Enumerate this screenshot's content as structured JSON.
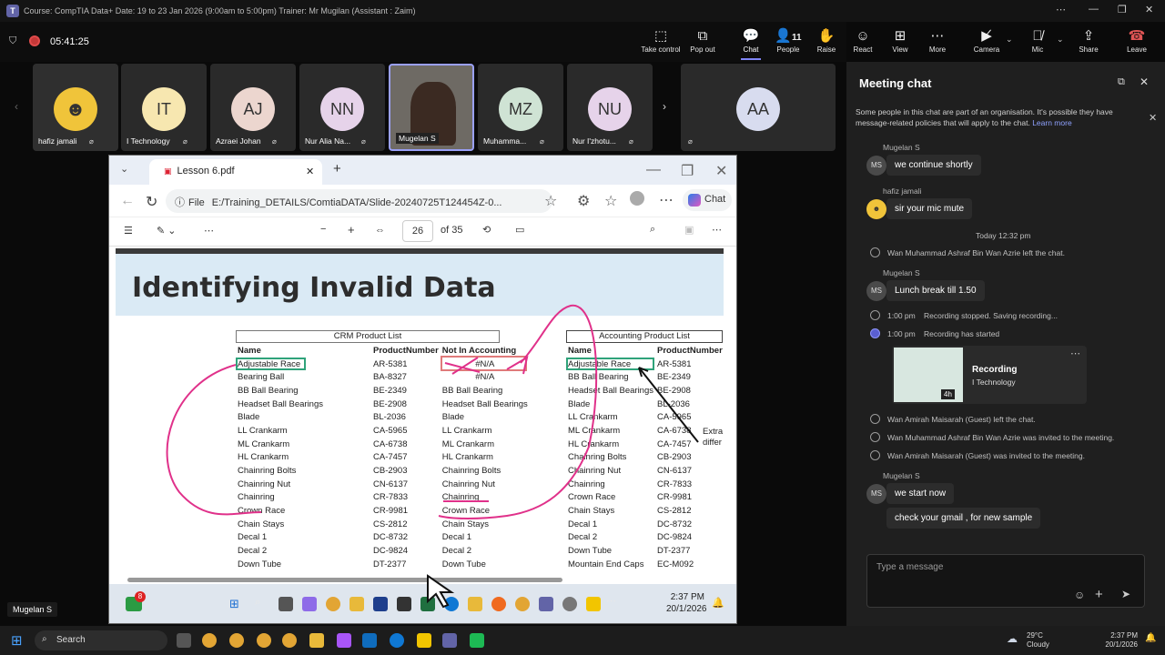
{
  "app": {
    "title": "Course: CompTIA Data+ Date: 19 to 23 Jan 2026 (9:00am to 5:00pm) Trainer: Mr Mugilan (Assistant : Zaim)",
    "timer": "05:41:25"
  },
  "toolbar": {
    "take_control": "Take control",
    "pop_out": "Pop out",
    "chat": "Chat",
    "people": "People",
    "people_count": "11",
    "raise": "Raise",
    "react": "React",
    "view": "View",
    "more": "More",
    "camera": "Camera",
    "mic": "Mic",
    "share": "Share",
    "leave": "Leave"
  },
  "participants": [
    {
      "initials": "",
      "name": "hafiz jamali"
    },
    {
      "initials": "IT",
      "name": "I Technology"
    },
    {
      "initials": "AJ",
      "name": "Azraei Johan"
    },
    {
      "initials": "NN",
      "name": "Nur Alia Na..."
    },
    {
      "initials": "",
      "name": "Mugelan S"
    },
    {
      "initials": "MZ",
      "name": "Muhamma..."
    },
    {
      "initials": "NU",
      "name": "Nur I'zhotu..."
    },
    {
      "initials": "AA",
      "name": ""
    }
  ],
  "browser": {
    "tab_title": "Lesson 6.pdf",
    "url_label": "File",
    "url": "E:/Training_DETAILS/ComtiaDATA/Slide-20240725T124454Z-0...",
    "copilot": "Chat",
    "page_current": "26",
    "page_total": "of 35"
  },
  "slide": {
    "title": "Identifying Invalid Data",
    "crm_caption": "CRM Product List",
    "acct_caption": "Accounting Product List",
    "crm_headers": [
      "Name",
      "ProductNumber",
      "Not In Accounting"
    ],
    "acct_headers": [
      "Name",
      "ProductNumber"
    ],
    "crm_rows": [
      [
        "Adjustable Race",
        "AR-5381",
        "#N/A"
      ],
      [
        "Bearing Ball",
        "BA-8327",
        "#N/A"
      ],
      [
        "BB Ball Bearing",
        "BE-2349",
        "BB Ball Bearing"
      ],
      [
        "Headset Ball Bearings",
        "BE-2908",
        "Headset Ball Bearings"
      ],
      [
        "Blade",
        "BL-2036",
        "Blade"
      ],
      [
        "LL Crankarm",
        "CA-5965",
        "LL Crankarm"
      ],
      [
        "ML Crankarm",
        "CA-6738",
        "ML Crankarm"
      ],
      [
        "HL Crankarm",
        "CA-7457",
        "HL Crankarm"
      ],
      [
        "Chainring Bolts",
        "CB-2903",
        "Chainring Bolts"
      ],
      [
        "Chainring Nut",
        "CN-6137",
        "Chainring Nut"
      ],
      [
        "Chainring",
        "CR-7833",
        "Chainring"
      ],
      [
        "Crown Race",
        "CR-9981",
        "Crown Race"
      ],
      [
        "Chain Stays",
        "CS-2812",
        "Chain Stays"
      ],
      [
        "Decal 1",
        "DC-8732",
        "Decal 1"
      ],
      [
        "Decal 2",
        "DC-9824",
        "Decal 2"
      ],
      [
        "Down Tube",
        "DT-2377",
        "Down Tube"
      ]
    ],
    "acct_rows": [
      [
        "Adjustable Race",
        "AR-5381"
      ],
      [
        "BB Ball Bearing",
        "BE-2349"
      ],
      [
        "Headset Ball Bearings",
        "BE-2908"
      ],
      [
        "Blade",
        "BL-2036"
      ],
      [
        "LL Crankarm",
        "CA-5965"
      ],
      [
        "ML Crankarm",
        "CA-6738"
      ],
      [
        "HL Crankarm",
        "CA-7457"
      ],
      [
        "Chainring Bolts",
        "CB-2903"
      ],
      [
        "Chainring Nut",
        "CN-6137"
      ],
      [
        "Chainring",
        "CR-7833"
      ],
      [
        "Crown Race",
        "CR-9981"
      ],
      [
        "Chain Stays",
        "CS-2812"
      ],
      [
        "Decal 1",
        "DC-8732"
      ],
      [
        "Decal 2",
        "DC-9824"
      ],
      [
        "Down Tube",
        "DT-2377"
      ],
      [
        "Mountain End Caps",
        "EC-M092"
      ]
    ],
    "annotation": "Extra\ndiffer"
  },
  "remote_taskbar": {
    "time": "2:37 PM",
    "date": "20/1/2026",
    "badge": "8"
  },
  "chat": {
    "title": "Meeting chat",
    "notice": "Some people in this chat are part of an organisation. It's possible they have message-related policies that will apply to the chat.",
    "learn_more": "Learn more",
    "messages": [
      {
        "sender": "Mugelan S",
        "initials": "MS",
        "text": "we continue shortly"
      },
      {
        "sender": "hafiz jamali",
        "initials": "",
        "text": "sir your mic mute"
      }
    ],
    "day_sep": "Today 12:32 pm",
    "left1": "Wan Muhammad Ashraf Bin Wan Azrie left the chat.",
    "msg3_sender": "Mugelan S",
    "msg3_initials": "MS",
    "msg3": "Lunch break till 1.50",
    "rec_stop_time": "1:00 pm",
    "rec_stop": "Recording stopped. Saving recording...",
    "rec_start_time": "1:00 pm",
    "rec_start": "Recording has started",
    "rec_card_title": "Recording",
    "rec_card_sub": "I Technology",
    "rec_card_dur": "4h",
    "left2": "Wan Amirah Maisarah (Guest) left the chat.",
    "invite1": "Wan Muhammad Ashraf Bin Wan Azrie was invited to the meeting.",
    "invite2": "Wan Amirah Maisarah (Guest) was invited to the meeting.",
    "msg4_sender": "Mugelan S",
    "msg4_initials": "MS",
    "msg4": "we start now",
    "msg5": "check your gmail , for new sample",
    "input_placeholder": "Type a message"
  },
  "caption": "Mugelan S",
  "taskbar": {
    "search": "Search",
    "weather_temp": "29°C",
    "weather": "Cloudy",
    "time": "2:37 PM",
    "date": "20/1/2026"
  },
  "colors": {
    "accent": "#7f85f5",
    "leave": "#e05555",
    "annot_pink": "#e0318a",
    "highlight_green": "#2fa37a"
  }
}
